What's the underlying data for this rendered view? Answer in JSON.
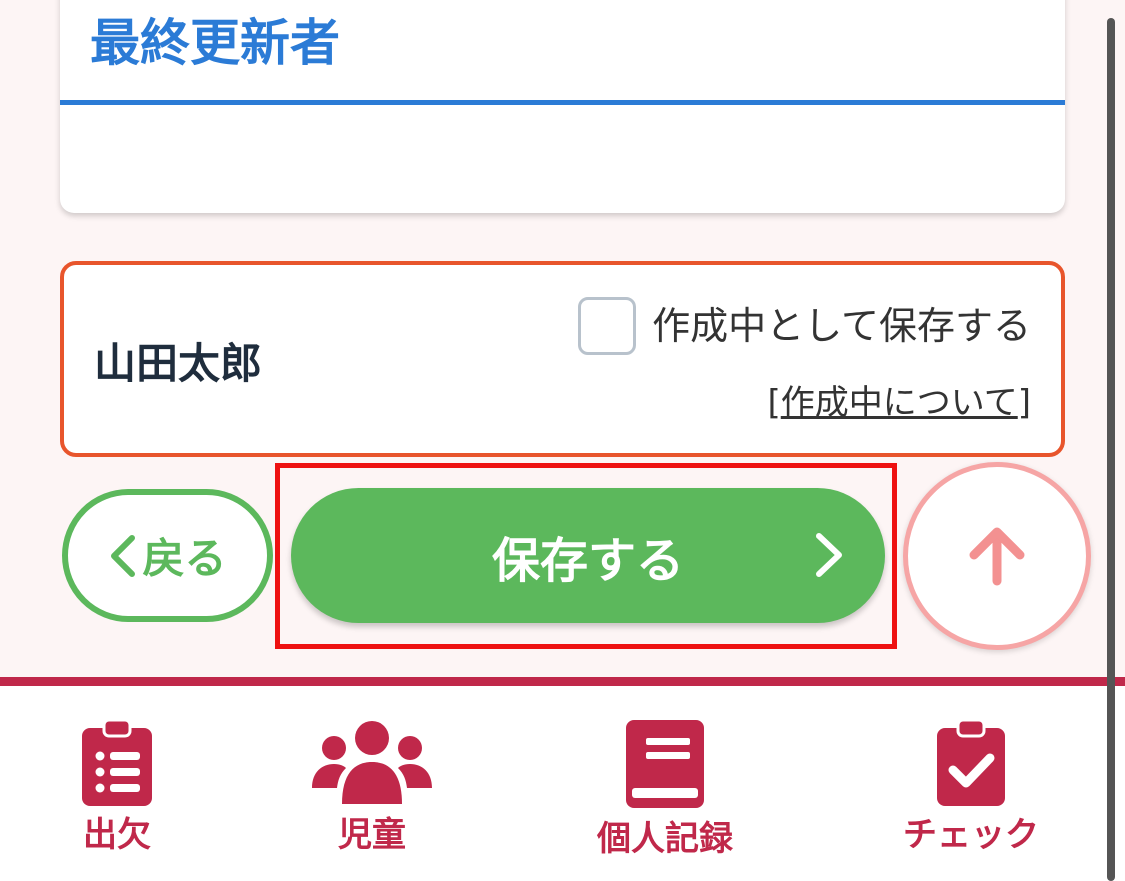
{
  "card": {
    "title": "最終更新者"
  },
  "author": {
    "name": "山田太郎",
    "draft_checkbox_label": "作成中として保存する",
    "draft_checked": false,
    "about_open": "[",
    "about_link": "作成中について",
    "about_close": "]"
  },
  "actions": {
    "back_label": "戻る",
    "save_label": "保存する"
  },
  "nav": {
    "items": [
      {
        "label": "出欠",
        "icon": "clipboard-list-icon"
      },
      {
        "label": "児童",
        "icon": "users-icon"
      },
      {
        "label": "個人記録",
        "icon": "book-icon"
      },
      {
        "label": "チェック",
        "icon": "clipboard-check-icon"
      }
    ]
  },
  "colors": {
    "accent_blue": "#2b7bd6",
    "primary_green": "#5cb85c",
    "nav_crimson": "#c0284a",
    "alert_orange": "#e8552c",
    "highlight_red": "#ee1111"
  }
}
